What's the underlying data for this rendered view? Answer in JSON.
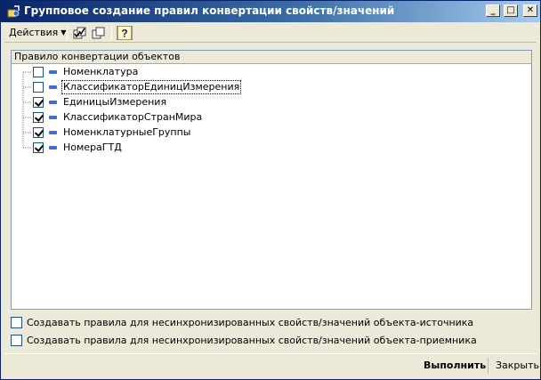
{
  "window": {
    "title": "Групповое создание правил конвертации свойств/значений",
    "minimize_glyph": "_",
    "maximize_glyph": "□",
    "close_glyph": "✕"
  },
  "toolbar": {
    "actions_label": "Действия",
    "icons": [
      "check-all-icon",
      "copy-icon",
      "help-icon"
    ]
  },
  "tree": {
    "column_header": "Правило конвертации объектов",
    "items": [
      {
        "label": "Номенклатура",
        "checked": false
      },
      {
        "label": "КлассификаторЕдиницИзмерения",
        "checked": false,
        "focused": true
      },
      {
        "label": "ЕдиницыИзмерения",
        "checked": true
      },
      {
        "label": "КлассификаторСтранМира",
        "checked": true
      },
      {
        "label": "НоменклатурныеГруппы",
        "checked": true
      },
      {
        "label": "НомераГТД",
        "checked": true
      }
    ]
  },
  "options": {
    "source_label": "Создавать правила для несинхронизированных свойств/значений объекта-источника",
    "target_label": "Создавать правила для несинхронизированных свойств/значений объекта-приемника",
    "source_checked": false,
    "target_checked": false
  },
  "footer": {
    "execute_label": "Выполнить",
    "close_label": "Закрыть"
  },
  "colors": {
    "title_gradient_start": "#0a246a",
    "title_gradient_end": "#a6caf0",
    "window_bg": "#ece9d8",
    "item_marker": "#3c6ed8"
  }
}
